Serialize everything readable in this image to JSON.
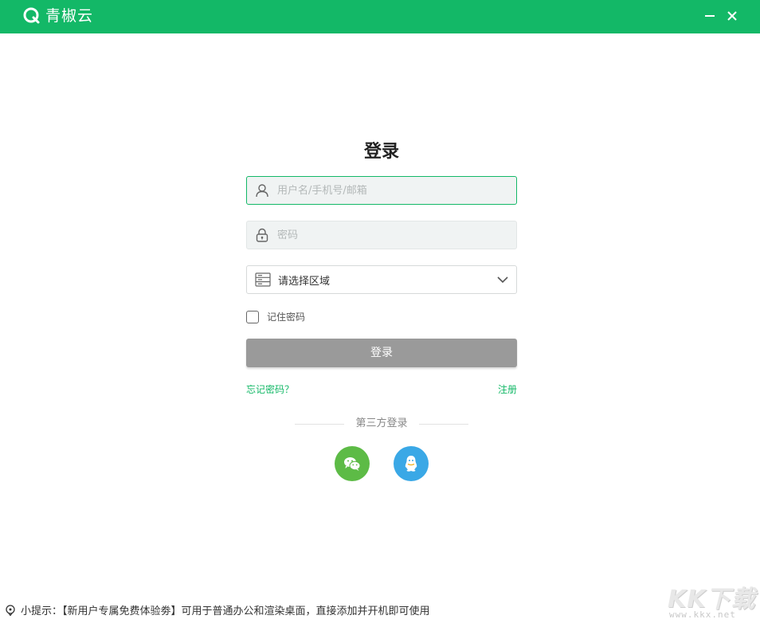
{
  "app": {
    "name": "青椒云",
    "brand_color": "#13b867"
  },
  "window_controls": {
    "minimize_icon": "minimize-icon",
    "close_icon": "close-icon"
  },
  "login": {
    "title": "登录",
    "username_placeholder": "用户名/手机号/邮箱",
    "password_placeholder": "密码",
    "region_value": "请选择区域",
    "remember_label": "记住密码",
    "remember_checked": false,
    "submit_label": "登录",
    "forgot_label": "忘记密码？",
    "register_label": "注册",
    "third_party_label": "第三方登录",
    "third_party": [
      {
        "name": "wechat",
        "icon": "wechat-icon",
        "color": "#5dbb46"
      },
      {
        "name": "qq",
        "icon": "qq-icon",
        "color": "#3aa8e6"
      }
    ]
  },
  "footer": {
    "tip_text": "小提示：【新用户专属免费体验劵】可用于普通办公和渲染桌面，直接添加并开机即可使用"
  },
  "watermark": {
    "logo": "KK下载",
    "url": "www.kkx.net"
  }
}
